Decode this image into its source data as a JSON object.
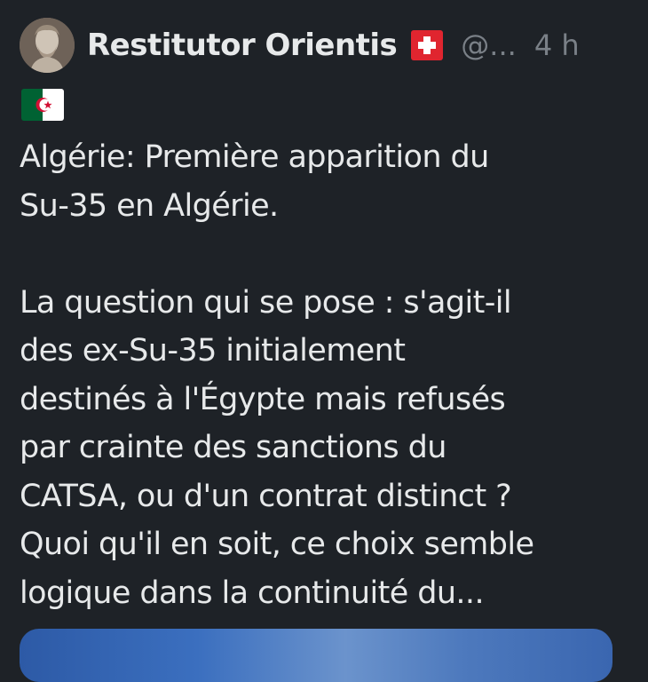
{
  "tweet": {
    "author": {
      "display_name": "Restitutor Orientis",
      "flag_icon": "swiss-flag-icon",
      "handle": "@...",
      "time": "4 h"
    },
    "leading_flag_icon": "algeria-flag-icon",
    "lines": [
      "Algérie: Première apparition du",
      "Su-35 en Algérie.",
      "",
      "La question qui se pose : s'agit-il",
      "des ex-Su-35 initialement",
      "destinés à l'Égypte mais refusés",
      "par crainte des sanctions du",
      "CATSA, ou d'un contrat distinct ?",
      "Quoi qu'il en soit, ce choix semble",
      "logique dans la continuité du..."
    ]
  },
  "colors": {
    "background": "#1e2227",
    "text": "#e7e9ea",
    "secondary_text": "#7a8087",
    "swiss_red": "#e0252f",
    "algeria_green": "#006233",
    "algeria_red": "#d21034"
  }
}
